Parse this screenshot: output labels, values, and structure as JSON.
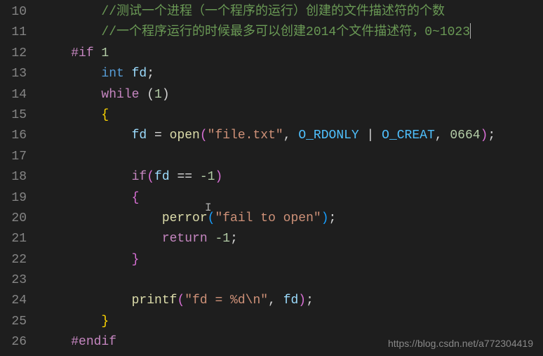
{
  "lines": {
    "10": "10",
    "11": "11",
    "12": "12",
    "13": "13",
    "14": "14",
    "15": "15",
    "16": "16",
    "17": "17",
    "18": "18",
    "19": "19",
    "20": "20",
    "21": "21",
    "22": "22",
    "23": "23",
    "24": "24",
    "25": "25",
    "26": "26"
  },
  "code": {
    "comment1": "//测试一个进程（一个程序的运行）创建的文件描述符的个数",
    "comment2": "//一个程序运行的时候最多可以创建2014个文件描述符，0~1023",
    "if_directive": "#if",
    "if_val": " 1",
    "int_kw": "int",
    "fd_var": " fd",
    "semi": ";",
    "while_kw": "while",
    "while_cond": " (",
    "one": "1",
    "close_paren": ")",
    "open_brace": "{",
    "close_brace": "}",
    "fd_assign": "fd ",
    "equals": "= ",
    "open_fn": "open",
    "open_paren": "(",
    "file_str": "\"file.txt\"",
    "comma_sp": ", ",
    "o_rdonly": "O_RDONLY",
    "pipe": " | ",
    "o_creat": "O_CREAT",
    "mode": "0664",
    "close_paren_semi": ");",
    "if_kw": "if",
    "eq_op": " == ",
    "neg_one": "-1",
    "perror_fn": "perror",
    "fail_str": "\"fail to open\"",
    "return_kw": "return",
    "space": " ",
    "printf_fn": "printf",
    "fmt_str": "\"fd = %d\\n\"",
    "fd_arg": "fd",
    "endif": "#endif"
  },
  "watermark": "https://blog.csdn.net/a772304419"
}
